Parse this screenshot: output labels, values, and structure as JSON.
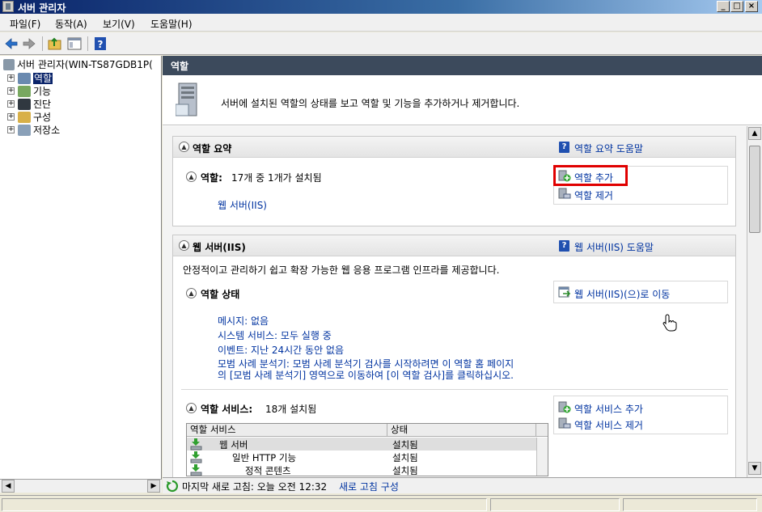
{
  "window": {
    "title": "서버 관리자",
    "controls": [
      "_",
      "□",
      "×"
    ]
  },
  "menu": {
    "items": [
      "파일(F)",
      "동작(A)",
      "보기(V)",
      "도움말(H)"
    ]
  },
  "tree": {
    "root": "서버 관리자(WIN-TS87GDB1P(",
    "nodes": [
      "역할",
      "기능",
      "진단",
      "구성",
      "저장소"
    ]
  },
  "main": {
    "header": "역할",
    "intro": "서버에 설치된 역할의 상태를 보고 역할 및 기능을 추가하거나 제거합니다."
  },
  "roles_summary": {
    "title": "역할 요약",
    "help_link": "역할 요약 도움말",
    "count_label": "역할:",
    "count_text": "17개 중 1개가 설치됨",
    "installed_role": "웹 서버(IIS)",
    "add_roles": "역할 추가",
    "remove_roles": "역할 제거"
  },
  "web_server": {
    "title": "웹 서버(IIS)",
    "help_link": "웹 서버(IIS) 도움말",
    "description": "안정적이고 관리하기 쉽고 확장 가능한 웹 응용 프로그램 인프라를 제공합니다.",
    "status_title": "역할 상태",
    "goto_link": "웹 서버(IIS)(으)로 이동",
    "status_lines": [
      "메시지: 없음",
      "시스템 서비스: 모두 실행 중",
      "이벤트: 지난 24시간 동안 없음",
      "모범 사례 분석기: 모범 사례 분석기 검사를 시작하려면 이 역할 홈 페이지",
      "의 [모범 사례 분석기] 영역으로 이동하여 [이 역할 검사]를 클릭하십시오."
    ],
    "services_title": "역할 서비스:",
    "services_count": "18개 설치됨",
    "add_services": "역할 서비스 추가",
    "remove_services": "역할 서비스 제거",
    "table": {
      "headers": [
        "역할 서비스",
        "상태"
      ],
      "rows": [
        {
          "name": "웹 서버",
          "status": "설치됨"
        },
        {
          "name": "일반 HTTP 기능",
          "status": "설치됨"
        },
        {
          "name": "정적 콘텐츠",
          "status": "설치됨"
        }
      ]
    }
  },
  "refresh": {
    "text": "마지막 새로 고침: 오늘 오전 12:32",
    "link": "새로 고침 구성"
  },
  "colors": {
    "link": "#0033a0",
    "highlight": "#e00000",
    "header_bg": "#3c4a5c"
  }
}
